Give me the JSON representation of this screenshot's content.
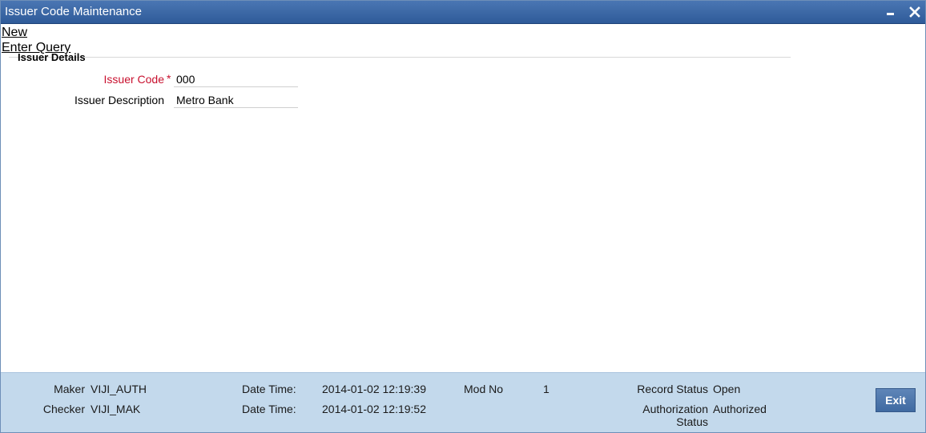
{
  "window": {
    "title": "Issuer Code Maintenance",
    "controls": [
      "minimize-icon",
      "close-icon"
    ]
  },
  "menu": {
    "new_label": "New",
    "enter_query_label": "Enter Query"
  },
  "section": {
    "legend": "Issuer Details"
  },
  "form": {
    "issuer_code": {
      "label": "Issuer Code",
      "required_marker": "*",
      "value": "000"
    },
    "issuer_description": {
      "label": "Issuer Description",
      "value": "Metro Bank"
    }
  },
  "footer": {
    "maker_label": "Maker",
    "maker_value": "VIJI_AUTH",
    "checker_label": "Checker",
    "checker_value": "VIJI_MAK",
    "maker_datetime_label": "Date Time:",
    "maker_datetime_value": "2014-01-02 12:19:39",
    "checker_datetime_label": "Date Time:",
    "checker_datetime_value": "2014-01-02 12:19:52",
    "mod_no_label": "Mod No",
    "mod_no_value": "1",
    "record_status_label": "Record Status",
    "record_status_value": "Open",
    "auth_status_label_line1": "Authorization",
    "auth_status_label_line2": "Status",
    "auth_status_value": "Authorized",
    "exit_label": "Exit"
  },
  "colors": {
    "titlebar": "#2f5b99",
    "required_label": "#c8102e",
    "footer_bg": "#c3d9ec",
    "exit_button": "#3f6aa1"
  }
}
